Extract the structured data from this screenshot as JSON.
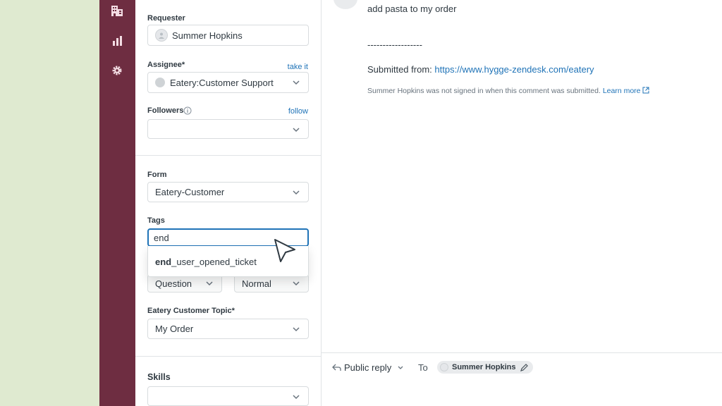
{
  "fields": {
    "requester": {
      "label": "Requester",
      "value": "Summer Hopkins"
    },
    "assignee": {
      "label": "Assignee*",
      "link": "take it",
      "value": "Eatery:Customer Support"
    },
    "followers": {
      "label": "Followers",
      "link": "follow",
      "value": ""
    },
    "form": {
      "label": "Form",
      "value": "Eatery-Customer"
    },
    "tags": {
      "label": "Tags",
      "value": "end",
      "suggestion_match": "end",
      "suggestion_rest": "_user_opened_ticket"
    },
    "type": {
      "value": "Question"
    },
    "priority": {
      "value": "Normal"
    },
    "topic": {
      "label": "Eatery Customer Topic*",
      "value": "My Order"
    },
    "skills": {
      "label": "Skills",
      "value": ""
    }
  },
  "conversation": {
    "message": "add pasta to my order",
    "separator": "------------------",
    "submitted_label": "Submitted from:",
    "submitted_url": "https://www.hygge-zendesk.com/eatery",
    "note": "Summer Hopkins was not signed in when this comment was submitted.",
    "learn_more": "Learn more"
  },
  "reply": {
    "mode": "Public reply",
    "to_label": "To",
    "recipient": "Summer Hopkins"
  },
  "colors": {
    "rail": "#6e2d41",
    "link": "#1f73b7",
    "focus": "#1f73b7",
    "background": "#dfead0"
  },
  "icons": [
    "building-icon",
    "bar-chart-icon",
    "gear-icon",
    "info-icon",
    "chevron-down-icon",
    "external-link-icon",
    "reply-icon",
    "pencil-icon",
    "cursor-arrow-icon"
  ]
}
